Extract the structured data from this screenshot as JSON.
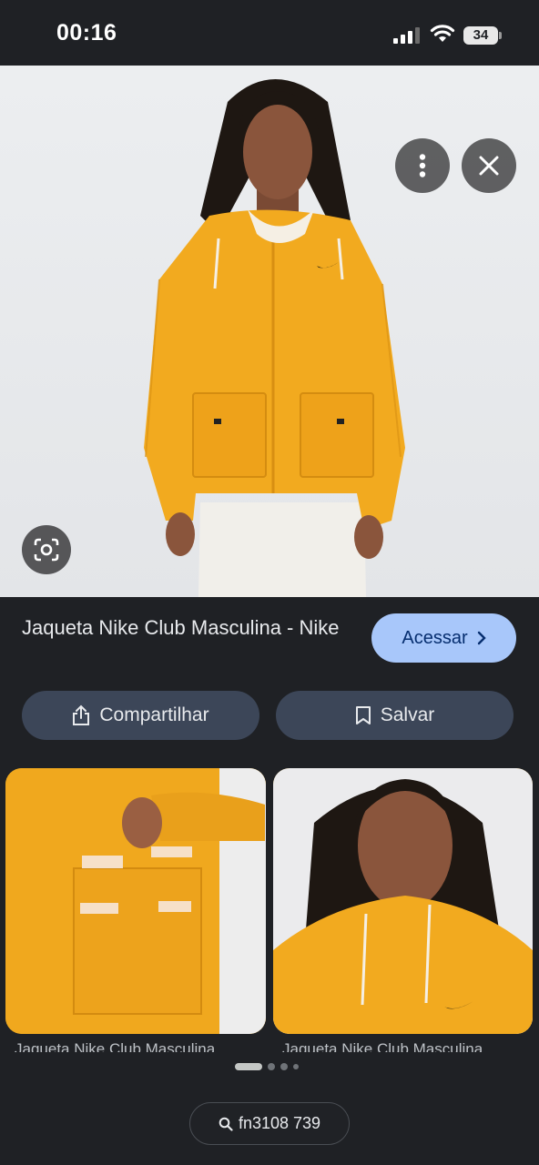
{
  "status_bar": {
    "time": "00:16",
    "battery_level": "34"
  },
  "hero": {
    "image_description_icon": "product-photo",
    "menu_icon": "more-vert-icon",
    "close_icon": "close-icon",
    "lens_icon": "lens-icon"
  },
  "result": {
    "title": "Jaqueta Nike Club Masculina - Nike",
    "visit_label": "Acessar"
  },
  "actions": {
    "share_label": "Compartilhar",
    "save_label": "Salvar"
  },
  "related": {
    "items": [
      {
        "caption": "Jaqueta Nike Club Masculina"
      },
      {
        "caption": "Jaqueta Nike Club Masculina"
      }
    ]
  },
  "pagination": {
    "count": 4,
    "active": 0
  },
  "search": {
    "query": "fn3108 739"
  },
  "colors": {
    "background": "#1f2125",
    "accent_button": "#a8c7fa",
    "secondary_button": "#3c4658",
    "jacket_yellow": "#f2aa1f"
  }
}
